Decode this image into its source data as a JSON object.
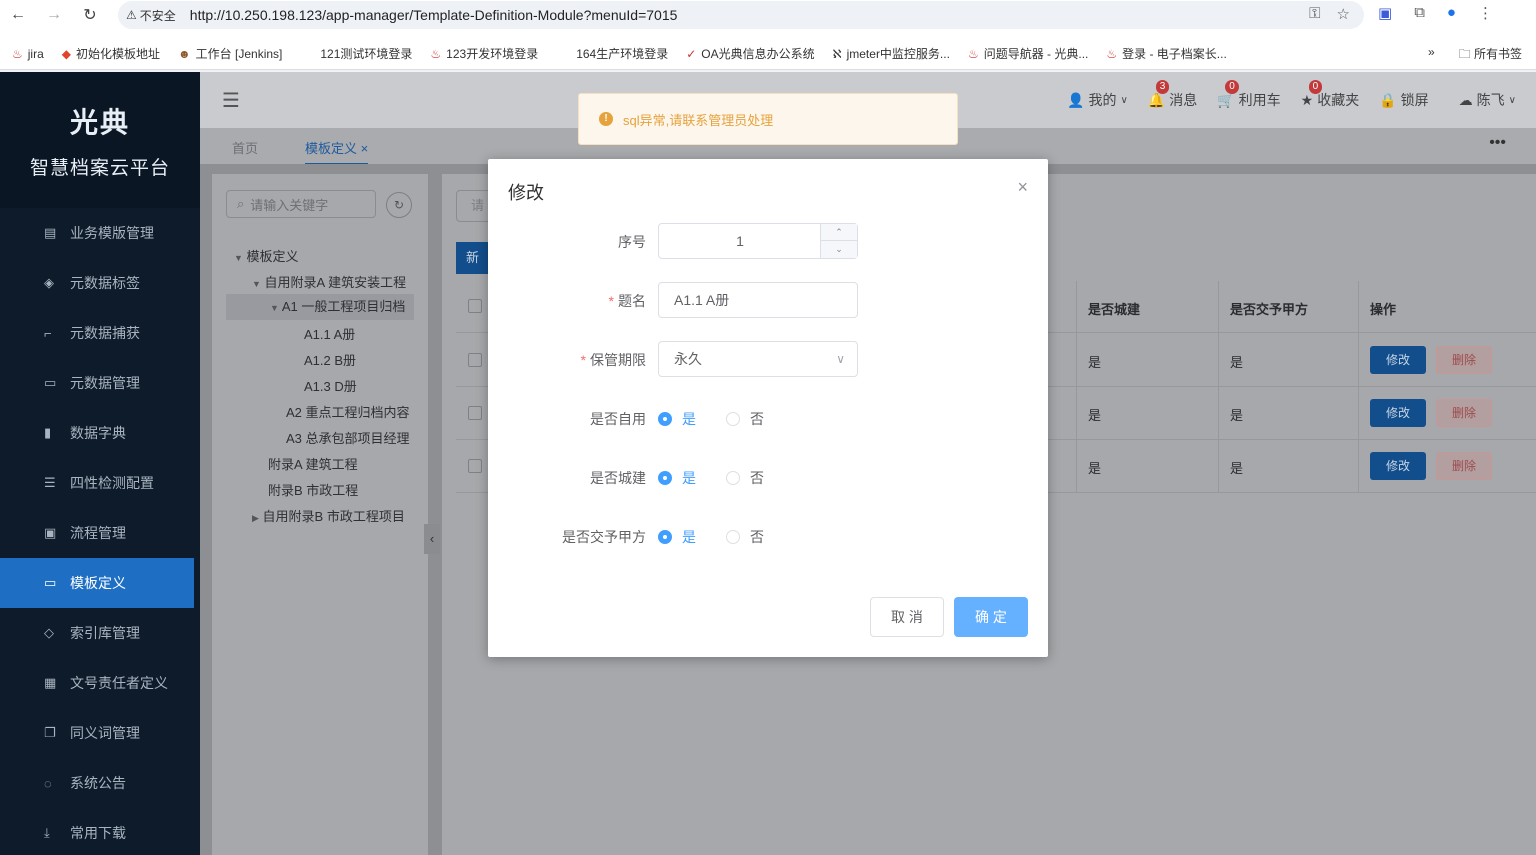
{
  "browser": {
    "insecure_label": "不安全",
    "url": "http://10.250.198.123/app-manager/Template-Definition-Module?menuId=7015",
    "bookmarks": [
      "jira",
      "初始化模板地址",
      "工作台 [Jenkins]",
      "121测试环境登录",
      "123开发环境登录",
      "164生产环境登录",
      "OA光典信息办公系统",
      "jmeter中监控服务...",
      "问题导航器 - 光典...",
      "登录 - 电子档案长..."
    ],
    "more_bookmarks": "»",
    "all_bookmarks": "所有书签"
  },
  "sidebar": {
    "logo": "光典",
    "platform_name": "智慧档案云平台",
    "items": [
      {
        "label": "业务模版管理",
        "icon": "list-icon"
      },
      {
        "label": "元数据标签",
        "icon": "tag-icon"
      },
      {
        "label": "元数据捕获",
        "icon": "crop-icon"
      },
      {
        "label": "元数据管理",
        "icon": "card-icon"
      },
      {
        "label": "数据字典",
        "icon": "book-icon"
      },
      {
        "label": "四性检测配置",
        "icon": "sliders-icon"
      },
      {
        "label": "流程管理",
        "icon": "flow-icon"
      },
      {
        "label": "模板定义",
        "icon": "folder-icon"
      },
      {
        "label": "索引库管理",
        "icon": "layers-icon"
      },
      {
        "label": "文号责任者定义",
        "icon": "grid-icon"
      },
      {
        "label": "同义词管理",
        "icon": "copy-icon"
      },
      {
        "label": "系统公告",
        "icon": "chat-icon"
      },
      {
        "label": "常用下载",
        "icon": "download-icon"
      }
    ]
  },
  "topbar": {
    "mine": "我的",
    "messages": "消息",
    "messages_count": "3",
    "cart": "利用车",
    "cart_count": "0",
    "favorites": "收藏夹",
    "favorites_count": "0",
    "lock": "锁屏",
    "user": "陈飞"
  },
  "tabs": {
    "home": "首页",
    "current": "模板定义",
    "close": "×",
    "more": "•••"
  },
  "tree": {
    "search_placeholder": "请输入关键字",
    "nodes": [
      "模板定义",
      "自用附录A 建筑安装工程",
      "A1 一般工程项目归档",
      "A1.1 A册",
      "A1.2 B册",
      "A1.3 D册",
      "A2 重点工程归档内容",
      "A3 总承包部项目经理",
      "附录A 建筑工程",
      "附录B 市政工程",
      "自用附录B 市政工程项目"
    ]
  },
  "table": {
    "search_partial": "请",
    "new_partial": "新",
    "headers": [
      "是否城建",
      "是否交予甲方",
      "操作"
    ],
    "rows": [
      {
        "city": "是",
        "party": "是"
      },
      {
        "city": "是",
        "party": "是"
      },
      {
        "city": "是",
        "party": "是"
      }
    ],
    "edit_label": "修改",
    "delete_label": "删除"
  },
  "toast": {
    "message": "sql异常,请联系管理员处理",
    "icon": "!"
  },
  "modal": {
    "title": "修改",
    "close": "×",
    "seq_label": "序号",
    "seq_value": "1",
    "title_label": "题名",
    "title_value": "A1.1 A册",
    "retention_label": "保管期限",
    "retention_value": "永久",
    "self_use_label": "是否自用",
    "city_label": "是否城建",
    "party_label": "是否交予甲方",
    "yes": "是",
    "no": "否",
    "required_mark": "*",
    "cancel": "取 消",
    "confirm": "确 定"
  }
}
